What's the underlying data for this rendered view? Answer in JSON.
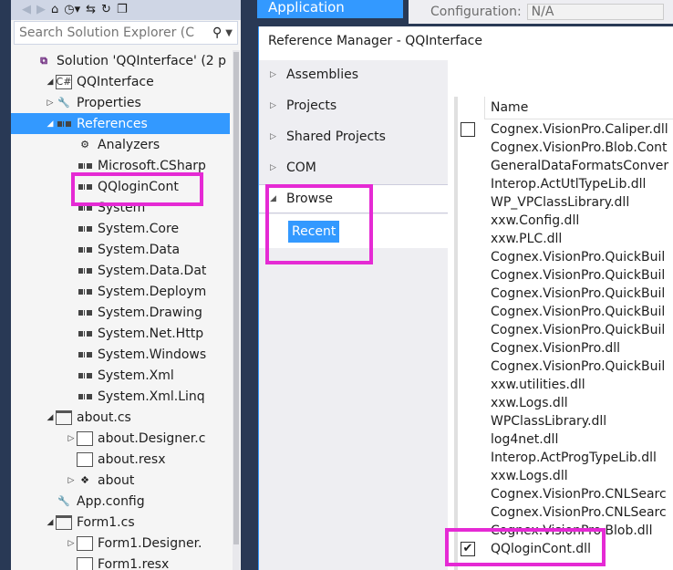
{
  "solution_explorer": {
    "search_placeholder": "Search Solution Explorer (C",
    "toolbar_icons": [
      "back-icon",
      "forward-icon",
      "home-icon",
      "history-icon",
      "sync-icon",
      "refresh-icon",
      "collapse-icon"
    ],
    "tree": [
      {
        "label": "Solution 'QQInterface' (2 p",
        "icon": "solution-icon",
        "indent": 0,
        "expander": ""
      },
      {
        "label": "QQInterface",
        "icon": "csharp-project-icon",
        "indent": 1,
        "expander": "◢"
      },
      {
        "label": "Properties",
        "icon": "wrench-icon",
        "indent": 2,
        "expander": "▷"
      },
      {
        "label": "References",
        "icon": "references-icon",
        "indent": 2,
        "expander": "◢",
        "selected": true
      },
      {
        "label": "Analyzers",
        "icon": "analyzer-icon",
        "indent": 3,
        "expander": ""
      },
      {
        "label": "Microsoft.CSharp",
        "icon": "reference-icon",
        "indent": 3,
        "expander": ""
      },
      {
        "label": "QQloginCont",
        "icon": "reference-icon",
        "indent": 3,
        "expander": ""
      },
      {
        "label": "System",
        "icon": "reference-icon",
        "indent": 3,
        "expander": ""
      },
      {
        "label": "System.Core",
        "icon": "reference-icon",
        "indent": 3,
        "expander": ""
      },
      {
        "label": "System.Data",
        "icon": "reference-icon",
        "indent": 3,
        "expander": ""
      },
      {
        "label": "System.Data.Dat",
        "icon": "reference-icon",
        "indent": 3,
        "expander": ""
      },
      {
        "label": "System.Deploym",
        "icon": "reference-icon",
        "indent": 3,
        "expander": ""
      },
      {
        "label": "System.Drawing",
        "icon": "reference-icon",
        "indent": 3,
        "expander": ""
      },
      {
        "label": "System.Net.Http",
        "icon": "reference-icon",
        "indent": 3,
        "expander": ""
      },
      {
        "label": "System.Windows",
        "icon": "reference-icon",
        "indent": 3,
        "expander": ""
      },
      {
        "label": "System.Xml",
        "icon": "reference-icon",
        "indent": 3,
        "expander": ""
      },
      {
        "label": "System.Xml.Linq",
        "icon": "reference-icon",
        "indent": 3,
        "expander": ""
      },
      {
        "label": "about.cs",
        "icon": "form-icon",
        "indent": 2,
        "expander": "◢"
      },
      {
        "label": "about.Designer.c",
        "icon": "file-icon",
        "indent": 3,
        "expander": "▷"
      },
      {
        "label": "about.resx",
        "icon": "file-icon",
        "indent": 3,
        "expander": ""
      },
      {
        "label": "about",
        "icon": "class-icon",
        "indent": 3,
        "expander": "▷"
      },
      {
        "label": "App.config",
        "icon": "config-icon",
        "indent": 2,
        "expander": ""
      },
      {
        "label": "Form1.cs",
        "icon": "form-icon",
        "indent": 2,
        "expander": "◢"
      },
      {
        "label": "Form1.Designer.",
        "icon": "file-icon",
        "indent": 3,
        "expander": "▷"
      },
      {
        "label": "Form1.resx",
        "icon": "file-icon",
        "indent": 3,
        "expander": ""
      }
    ]
  },
  "background": {
    "app_tab": "Application",
    "config_label": "Configuration:",
    "config_value": "N/A"
  },
  "dialog": {
    "title": "Reference Manager - QQInterface",
    "nav": [
      {
        "label": "Assemblies",
        "expander": "▷"
      },
      {
        "label": "Projects",
        "expander": "▷"
      },
      {
        "label": "Shared Projects",
        "expander": "▷"
      },
      {
        "label": "COM",
        "expander": "▷"
      },
      {
        "label": "Browse",
        "expander": "◢",
        "active": true
      }
    ],
    "browse_sub": "Recent",
    "column_name": "Name",
    "items": [
      {
        "name": "Cognex.VisionPro.Caliper.dll",
        "checked": false
      },
      {
        "name": "Cognex.VisionPro.Blob.Cont",
        "checked": null
      },
      {
        "name": "GeneralDataFormatsConver",
        "checked": null
      },
      {
        "name": "Interop.ActUtlTypeLib.dll",
        "checked": null
      },
      {
        "name": "WP_VPClassLibrary.dll",
        "checked": null
      },
      {
        "name": "xxw.Config.dll",
        "checked": null
      },
      {
        "name": "xxw.PLC.dll",
        "checked": null
      },
      {
        "name": "Cognex.VisionPro.QuickBuil",
        "checked": null
      },
      {
        "name": "Cognex.VisionPro.QuickBuil",
        "checked": null
      },
      {
        "name": "Cognex.VisionPro.QuickBuil",
        "checked": null
      },
      {
        "name": "Cognex.VisionPro.QuickBuil",
        "checked": null
      },
      {
        "name": "Cognex.VisionPro.QuickBuil",
        "checked": null
      },
      {
        "name": "Cognex.VisionPro.dll",
        "checked": null
      },
      {
        "name": "Cognex.VisionPro.QuickBuil",
        "checked": null
      },
      {
        "name": "xxw.utilities.dll",
        "checked": null
      },
      {
        "name": "xxw.Logs.dll",
        "checked": null
      },
      {
        "name": "WPClassLibrary.dll",
        "checked": null
      },
      {
        "name": "log4net.dll",
        "checked": null
      },
      {
        "name": "Interop.ActProgTypeLib.dll",
        "checked": null
      },
      {
        "name": "xxw.Logs.dll",
        "checked": null
      },
      {
        "name": "Cognex.VisionPro.CNLSearc",
        "checked": null
      },
      {
        "name": "Cognex.VisionPro.CNLSearc",
        "checked": null
      },
      {
        "name": "Cognex.VisionPro.Blob.dll",
        "checked": null
      },
      {
        "name": "QQloginCont.dll",
        "checked": true
      }
    ]
  },
  "colors": {
    "selection": "#3399ff",
    "highlight": "#e52ad4",
    "vs_dark": "#293955"
  }
}
